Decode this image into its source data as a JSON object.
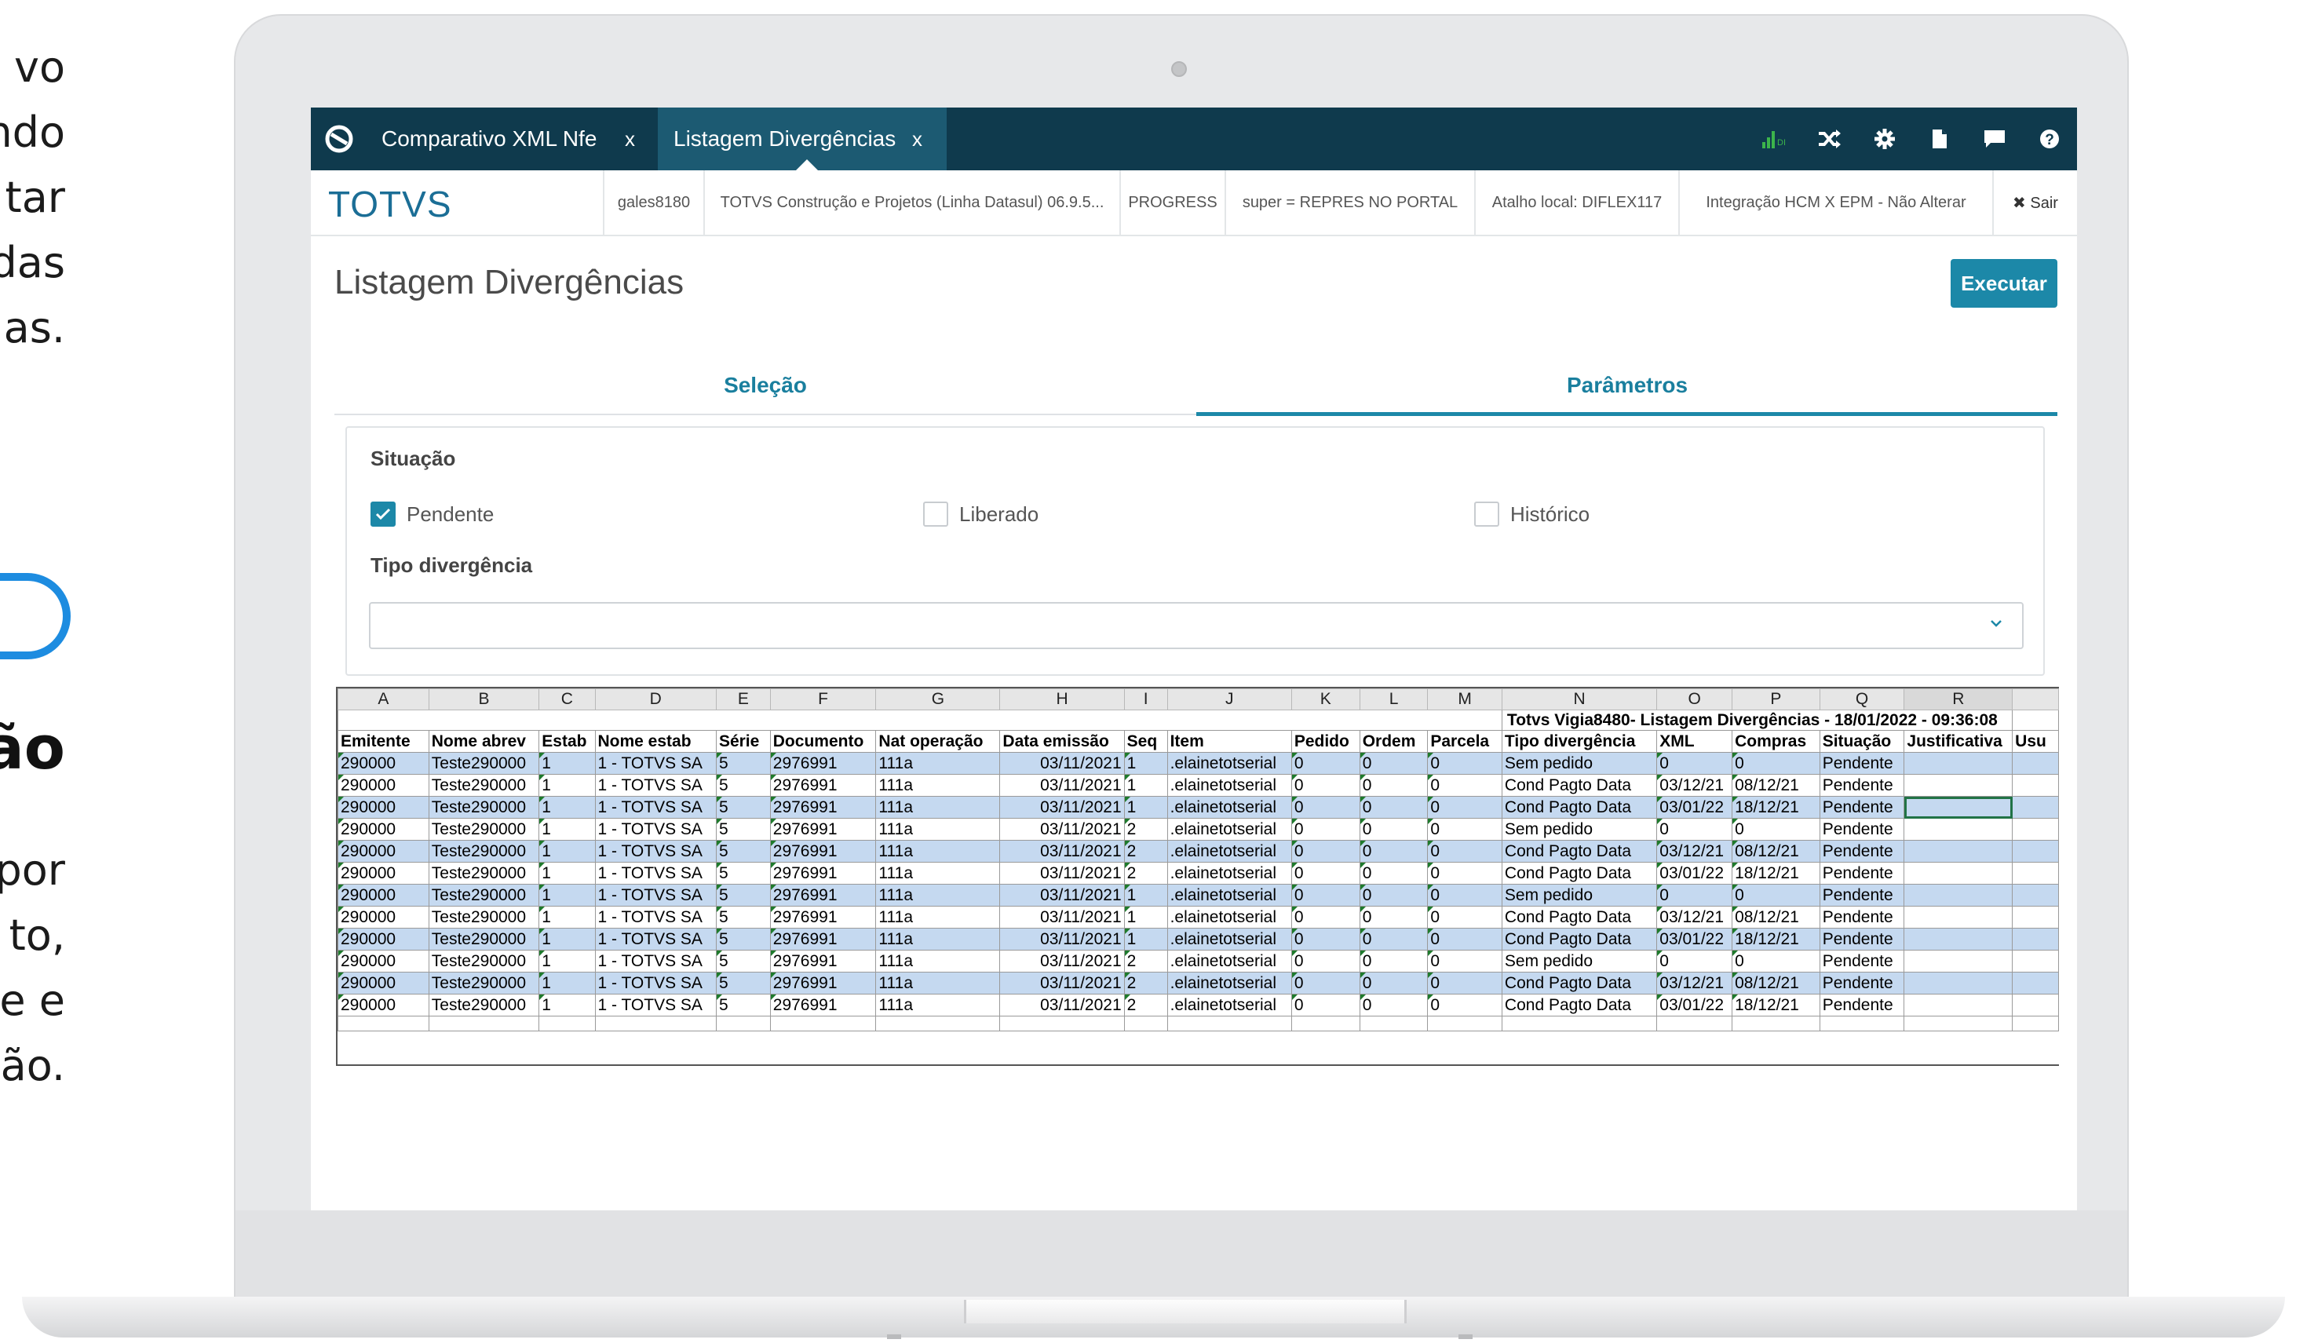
{
  "slide": {
    "lines_top": [
      "vo",
      "ndo",
      "tar",
      "das",
      "as."
    ],
    "heading_frag": "ão",
    "lines_bottom": [
      "por",
      "to,",
      "e e",
      "ão."
    ]
  },
  "app": {
    "tabs": [
      {
        "label": "Comparativo XML Nfe",
        "close": "x"
      },
      {
        "label": "Listagem Divergências",
        "close": "x"
      }
    ],
    "topbar_icons": [
      "signal-icon",
      "shuffle-icon",
      "gear-icon",
      "document-icon",
      "chat-icon",
      "help-icon"
    ],
    "brand": "TOTVS",
    "info": [
      "gales8180",
      "TOTVS Construção e Projetos (Linha Datasul) 06.9.5...",
      "PROGRESS",
      "super = REPRES NO PORTAL",
      "Atalho local: DIFLEX117",
      "Integração HCM X EPM - Não Alterar",
      "✖ Sair"
    ],
    "page_title": "Listagem Divergências",
    "execute_label": "Executar",
    "section_tabs": [
      "Seleção",
      "Parâmetros"
    ],
    "situacao_label": "Situação",
    "checkboxes": [
      {
        "label": "Pendente",
        "checked": true
      },
      {
        "label": "Liberado",
        "checked": false
      },
      {
        "label": "Histórico",
        "checked": false
      }
    ],
    "tipo_label": "Tipo divergência",
    "tipo_value": "",
    "colors": {
      "topbar": "#0f3a4d",
      "accent": "#1c88a8",
      "band": "#c5d9f0"
    }
  },
  "sheet": {
    "col_letters": [
      "A",
      "B",
      "C",
      "D",
      "E",
      "F",
      "G",
      "H",
      "I",
      "J",
      "K",
      "L",
      "M",
      "N",
      "O",
      "P",
      "Q",
      "R",
      ""
    ],
    "title": "Totvs Vigia8480- Listagem Divergências - 18/01/2022 - 09:36:08",
    "headers": [
      "Emitente",
      "Nome abrev",
      "Estab",
      "Nome estab",
      "Série",
      "Documento",
      "Nat operação",
      "Data emissão",
      "Seq",
      "Item",
      "Pedido",
      "Ordem",
      "Parcela",
      "Tipo divergência",
      "XML",
      "Compras",
      "Situação",
      "Justificativa",
      "Usu"
    ],
    "rows": [
      [
        "290000",
        "Teste290000",
        "1",
        "1 - TOTVS SA",
        "5",
        "2976991",
        "111a",
        "03/11/2021",
        "1",
        ".elainetotserial",
        "0",
        "0",
        "0",
        "Sem pedido",
        "0",
        "0",
        "Pendente",
        "",
        ""
      ],
      [
        "290000",
        "Teste290000",
        "1",
        "1 - TOTVS SA",
        "5",
        "2976991",
        "111a",
        "03/11/2021",
        "1",
        ".elainetotserial",
        "0",
        "0",
        "0",
        "Cond Pagto Data",
        "03/12/21",
        "08/12/21",
        "Pendente",
        "",
        ""
      ],
      [
        "290000",
        "Teste290000",
        "1",
        "1 - TOTVS SA",
        "5",
        "2976991",
        "111a",
        "03/11/2021",
        "1",
        ".elainetotserial",
        "0",
        "0",
        "0",
        "Cond Pagto Data",
        "03/01/22",
        "18/12/21",
        "Pendente",
        "",
        ""
      ],
      [
        "290000",
        "Teste290000",
        "1",
        "1 - TOTVS SA",
        "5",
        "2976991",
        "111a",
        "03/11/2021",
        "2",
        ".elainetotserial",
        "0",
        "0",
        "0",
        "Sem pedido",
        "0",
        "0",
        "Pendente",
        "",
        ""
      ],
      [
        "290000",
        "Teste290000",
        "1",
        "1 - TOTVS SA",
        "5",
        "2976991",
        "111a",
        "03/11/2021",
        "2",
        ".elainetotserial",
        "0",
        "0",
        "0",
        "Cond Pagto Data",
        "03/12/21",
        "08/12/21",
        "Pendente",
        "",
        ""
      ],
      [
        "290000",
        "Teste290000",
        "1",
        "1 - TOTVS SA",
        "5",
        "2976991",
        "111a",
        "03/11/2021",
        "2",
        ".elainetotserial",
        "0",
        "0",
        "0",
        "Cond Pagto Data",
        "03/01/22",
        "18/12/21",
        "Pendente",
        "",
        ""
      ],
      [
        "290000",
        "Teste290000",
        "1",
        "1 - TOTVS SA",
        "5",
        "2976991",
        "111a",
        "03/11/2021",
        "1",
        ".elainetotserial",
        "0",
        "0",
        "0",
        "Sem pedido",
        "0",
        "0",
        "Pendente",
        "",
        ""
      ],
      [
        "290000",
        "Teste290000",
        "1",
        "1 - TOTVS SA",
        "5",
        "2976991",
        "111a",
        "03/11/2021",
        "1",
        ".elainetotserial",
        "0",
        "0",
        "0",
        "Cond Pagto Data",
        "03/12/21",
        "08/12/21",
        "Pendente",
        "",
        ""
      ],
      [
        "290000",
        "Teste290000",
        "1",
        "1 - TOTVS SA",
        "5",
        "2976991",
        "111a",
        "03/11/2021",
        "1",
        ".elainetotserial",
        "0",
        "0",
        "0",
        "Cond Pagto Data",
        "03/01/22",
        "18/12/21",
        "Pendente",
        "",
        ""
      ],
      [
        "290000",
        "Teste290000",
        "1",
        "1 - TOTVS SA",
        "5",
        "2976991",
        "111a",
        "03/11/2021",
        "2",
        ".elainetotserial",
        "0",
        "0",
        "0",
        "Sem pedido",
        "0",
        "0",
        "Pendente",
        "",
        ""
      ],
      [
        "290000",
        "Teste290000",
        "1",
        "1 - TOTVS SA",
        "5",
        "2976991",
        "111a",
        "03/11/2021",
        "2",
        ".elainetotserial",
        "0",
        "0",
        "0",
        "Cond Pagto Data",
        "03/12/21",
        "08/12/21",
        "Pendente",
        "",
        ""
      ],
      [
        "290000",
        "Teste290000",
        "1",
        "1 - TOTVS SA",
        "5",
        "2976991",
        "111a",
        "03/11/2021",
        "2",
        ".elainetotserial",
        "0",
        "0",
        "0",
        "Cond Pagto Data",
        "03/01/22",
        "18/12/21",
        "Pendente",
        "",
        ""
      ]
    ]
  }
}
